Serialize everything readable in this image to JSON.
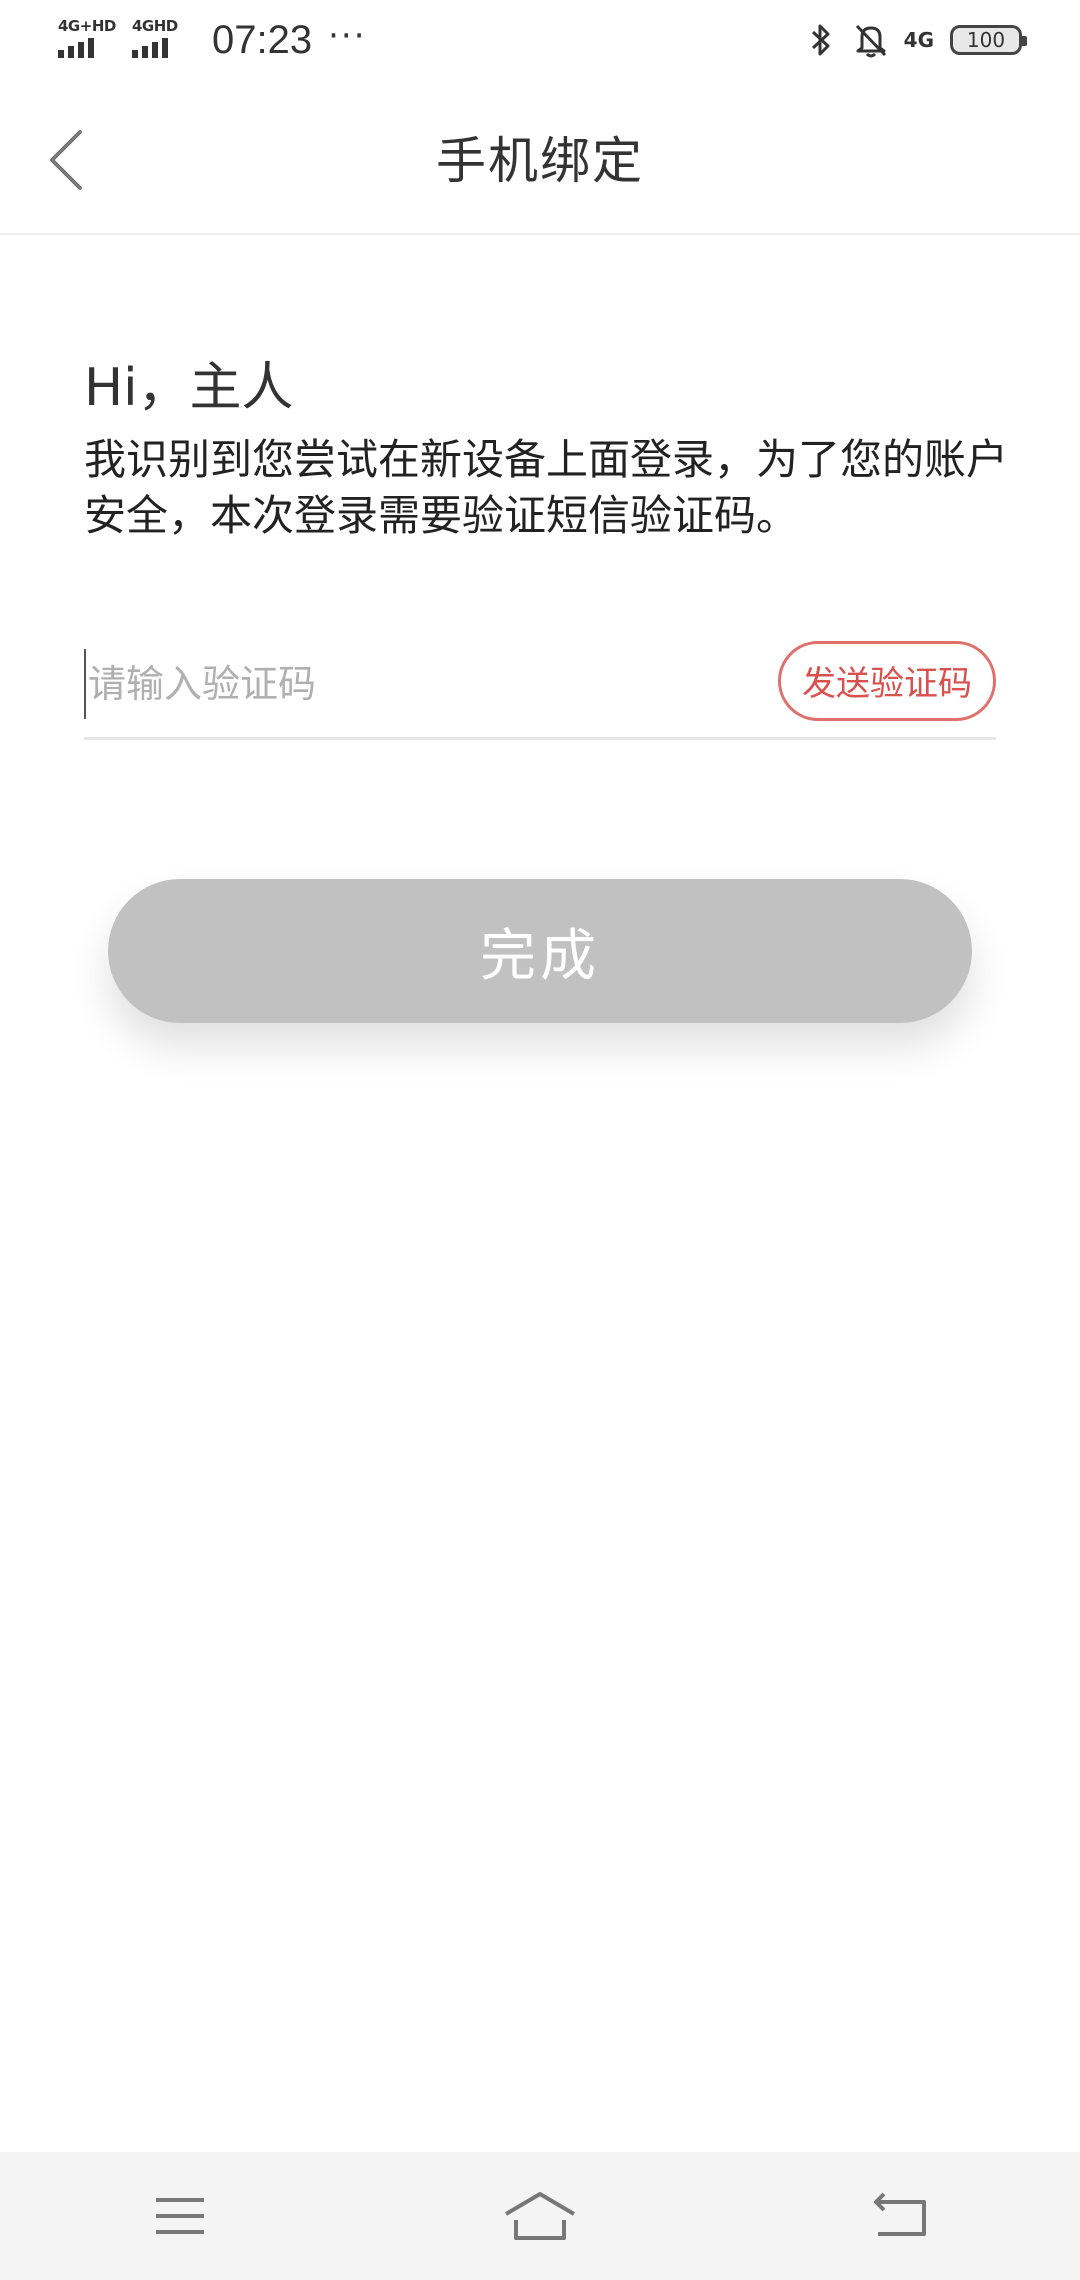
{
  "status_bar": {
    "sim1_label": "4G+HD",
    "sim2_label": "4GHD",
    "time": "07:23",
    "overflow": "···",
    "network": "4G",
    "battery": "100",
    "icons": [
      "bluetooth-icon",
      "mute-bell-icon"
    ]
  },
  "header": {
    "back_icon": "chevron-left-icon",
    "title": "手机绑定"
  },
  "main": {
    "greeting": "Hi，主人",
    "description": "我识别到您尝试在新设备上面登录，为了您的账户安全，本次登录需要验证短信验证码。",
    "code_input": {
      "placeholder": "请输入验证码",
      "value": ""
    },
    "send_code_label": "发送验证码",
    "done_label": "完成"
  },
  "nav_bar": {
    "icons": [
      "menu-icon",
      "home-icon",
      "back-icon"
    ]
  },
  "colors": {
    "accent": "#d9504c",
    "done_disabled": "#c1c1c1"
  }
}
